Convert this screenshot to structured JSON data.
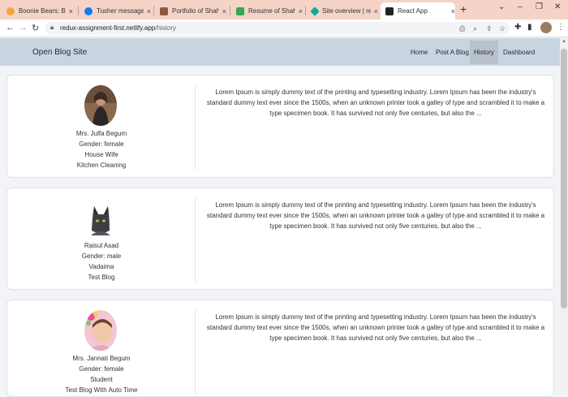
{
  "browser": {
    "tabs": [
      {
        "title": "Boonie Bears: Back to",
        "color": "#f4a340"
      },
      {
        "title": "Tusher messaged USA",
        "color": "#1877f2"
      },
      {
        "title": "Portfolio of Shahid",
        "color": "#8b5a3c"
      },
      {
        "title": "Resume of Shahidul Is",
        "color": "#34a853"
      },
      {
        "title": "Site overview | redux",
        "color": "#00ad9f"
      },
      {
        "title": "React App",
        "color": "#222222"
      }
    ],
    "url_host": "redux-assignment-first.netlify.app",
    "url_path": "/history",
    "new_tab": "+",
    "close_glyph": "×"
  },
  "site": {
    "brand": "Open Blog Site",
    "nav": [
      "Home",
      "Post A Blog",
      "History",
      "Dashboard"
    ]
  },
  "cards": [
    {
      "name": "Mrs. Julfa Begum",
      "gender": "Gender: female",
      "role": "House Wife",
      "title": "Kitchen Cleaning",
      "text": "Lorem Ipsum is simply dummy text of the printing and typesetting industry. Lorem Ipsum has been the industry's standard dummy text ever since the 1500s, when an unknown printer took a galley of type and scrambled it to make a type specimen book. It has survived not only five centuries, but also the ..."
    },
    {
      "name": "Raisul Asad",
      "gender": "Gender: male",
      "role": "Vadaima",
      "title": "Test Blog",
      "text": "Lorem Ipsum is simply dummy text of the printing and typesetting industry. Lorem Ipsum has been the industry's standard dummy text ever since the 1500s, when an unknown printer took a galley of type and scrambled it to make a type specimen book. It has survived not only five centuries, but also the ..."
    },
    {
      "name": "Mrs. Jannati Begum",
      "gender": "Gender: female",
      "role": "Student",
      "title": "Test Blog With Auto Time",
      "text": "Lorem Ipsum is simply dummy text of the printing and typesetting industry. Lorem Ipsum has been the industry's standard dummy text ever since the 1500s, when an unknown printer took a galley of type and scrambled it to make a type specimen book. It has survived not only five centuries, but also the ..."
    }
  ]
}
